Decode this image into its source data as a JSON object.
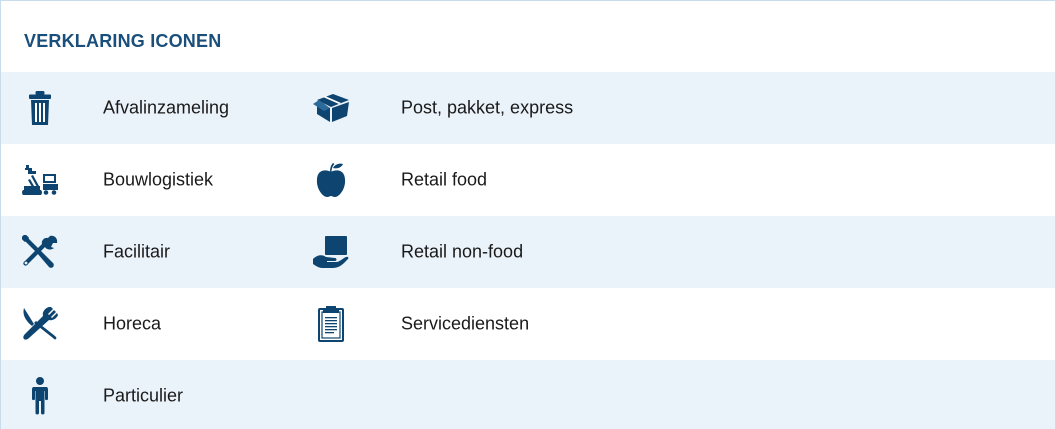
{
  "title": "VERKLARING ICONEN",
  "icon_color": "#0e4570",
  "title_color": "#1b4f7b",
  "stripe_color": "#eaf2fa",
  "rows": [
    {
      "left": {
        "icon": "trash-bin-icon",
        "label": "Afvalinzameling"
      },
      "right": {
        "icon": "package-box-icon",
        "label": "Post, pakket, express"
      }
    },
    {
      "left": {
        "icon": "crane-construction-icon",
        "label": "Bouwlogistiek"
      },
      "right": {
        "icon": "apple-icon",
        "label": "Retail food"
      }
    },
    {
      "left": {
        "icon": "wrench-screwdriver-icon",
        "label": "Facilitair"
      },
      "right": {
        "icon": "hand-holding-box-icon",
        "label": "Retail non-food"
      }
    },
    {
      "left": {
        "icon": "fork-knife-icon",
        "label": "Horeca"
      },
      "right": {
        "icon": "clipboard-icon",
        "label": "Servicediensten"
      }
    },
    {
      "left": {
        "icon": "person-icon",
        "label": "Particulier"
      }
    }
  ]
}
